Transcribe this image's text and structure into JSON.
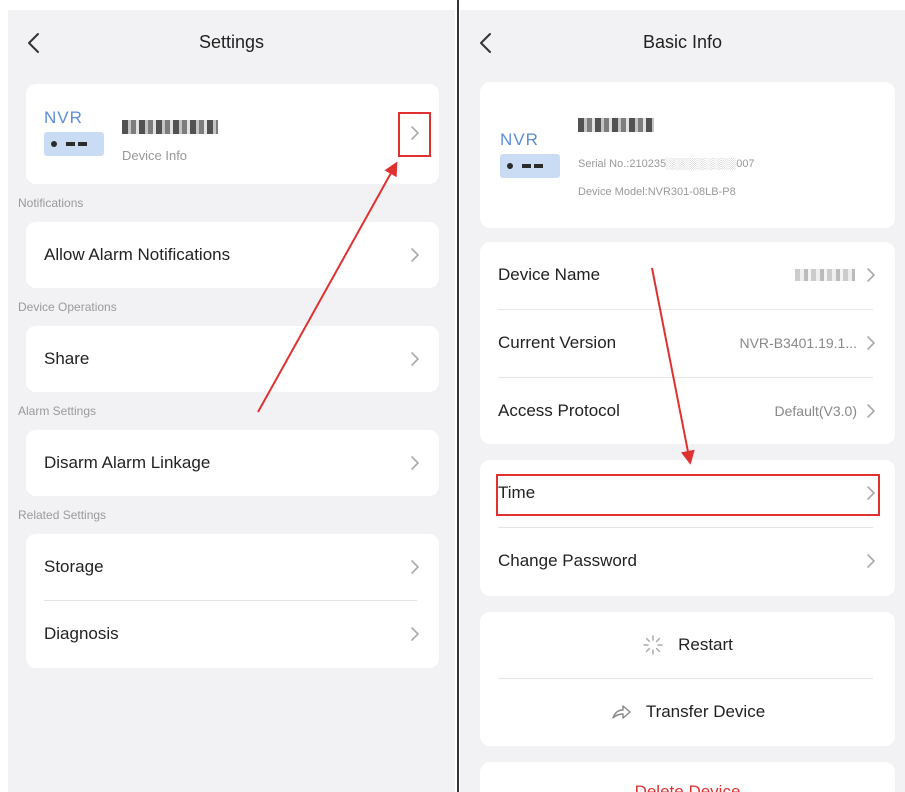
{
  "left": {
    "header_title": "Settings",
    "device_card": {
      "nvr_label": "NVR",
      "subtitle": "Device Info"
    },
    "sections": {
      "notifications": "Notifications",
      "device_operations": "Device Operations",
      "alarm_settings": "Alarm Settings",
      "related_settings": "Related Settings"
    },
    "rows": {
      "allow_alarm_notifications": "Allow Alarm Notifications",
      "share": "Share",
      "disarm_alarm_linkage": "Disarm Alarm Linkage",
      "storage": "Storage",
      "diagnosis": "Diagnosis"
    }
  },
  "right": {
    "header_title": "Basic Info",
    "device_card": {
      "nvr_label": "NVR",
      "serial": "Serial No.:210235░░░░░░░░░007",
      "model": "Device Model:NVR301-08LB-P8"
    },
    "rows": {
      "device_name": "Device Name",
      "current_version": "Current Version",
      "current_version_value": "NVR-B3401.19.1...",
      "access_protocol": "Access Protocol",
      "access_protocol_value": "Default(V3.0)",
      "time": "Time",
      "change_password": "Change Password"
    },
    "actions": {
      "restart": "Restart",
      "transfer_device": "Transfer Device",
      "delete_device": "Delete Device"
    }
  },
  "icons": {
    "back": "chevron-left-icon",
    "chevron": "chevron-right-icon",
    "restart": "spinner-icon",
    "transfer": "share-arrow-icon"
  },
  "colors": {
    "annotation_red": "#e03131",
    "nvr_blue": "#5b8fd8",
    "delete_red": "#e03131"
  }
}
